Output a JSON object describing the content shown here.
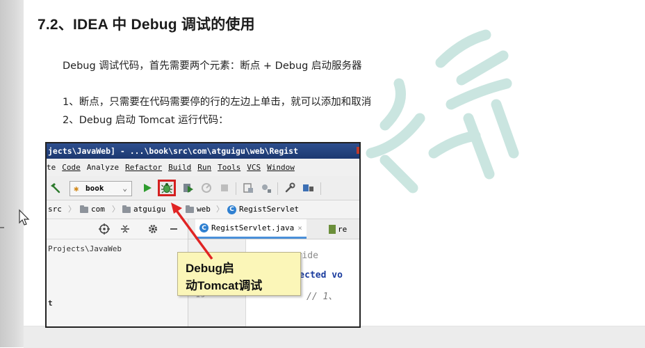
{
  "doc": {
    "heading": "7.2、IDEA 中 Debug 调试的使用",
    "line1": "Debug 调试代码，首先需要两个元素：断点 + Debug 启动服务器",
    "line2": "1、断点，只需要在代码需要停的行的左边上单击，就可以添加和取消",
    "line3": "2、Debug 启动 Tomcat 运行代码："
  },
  "ide": {
    "title": "jects\\JavaWeb] - ...\\book\\src\\com\\atguigu\\web\\Regist",
    "menu": [
      "te",
      "Code",
      "Analyze",
      "Refactor",
      "Build",
      "Run",
      "Tools",
      "VCS",
      "Window"
    ],
    "run_config": "book",
    "breadcrumbs": [
      "src",
      "com",
      "atguigu",
      "web",
      "RegistServlet"
    ],
    "project_path": "Projects\\JavaWeb",
    "left_fragment": "t",
    "tabs": [
      "RegistServlet.java",
      "re"
    ],
    "code": {
      "line_override": "erride",
      "line_protected": "protected vo",
      "line_number": "19",
      "line_comment": "//  1、"
    }
  },
  "callout": {
    "line1": "Debug启",
    "line2": "动Tomcat调试"
  },
  "colors": {
    "highlight_border": "#d42020",
    "callout_bg": "#fbf6b8",
    "arrow": "#e02424",
    "title_bar": "#1c3870",
    "watermark": "#b9ddd6"
  }
}
